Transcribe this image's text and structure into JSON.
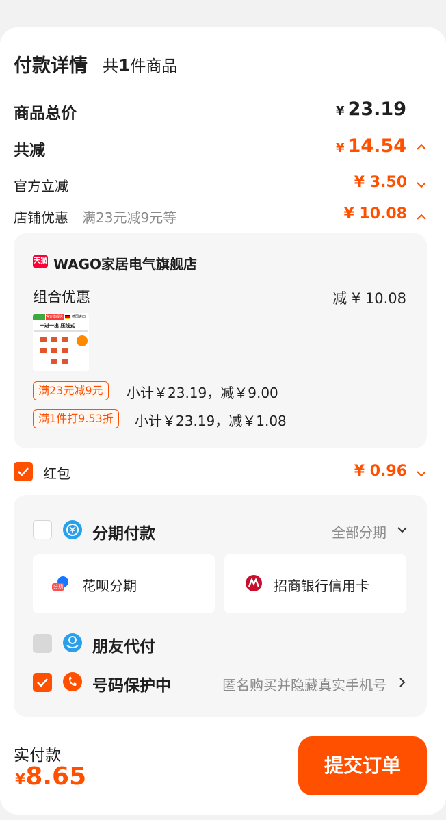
{
  "header": {
    "title": "付款详情",
    "count_text_prefix": "共",
    "count": "1",
    "count_text_suffix": "件商品"
  },
  "summary": {
    "total_label": "商品总价",
    "total_currency": "¥",
    "total_value": "23.19",
    "discount_label": "共减",
    "discount_currency": "¥",
    "discount_value": "14.54",
    "official_label": "官方立减",
    "official_value": "¥ 3.50",
    "shop_label": "店铺优惠",
    "shop_note": "满23元减9元等",
    "shop_value": "¥ 10.08"
  },
  "store": {
    "logo_text": "天猫",
    "name": "WAGO家居电气旗舰店",
    "combo_label": "组合优惠",
    "combo_prefix": "减",
    "combo_value": "¥ 10.08",
    "thumb": {
      "top_left": "官方旗舰店",
      "top_right": "德国进口",
      "headline": "一进一出 压线式"
    },
    "promos": [
      {
        "tag": "满23元减9元",
        "text": "小计￥23.19，减￥9.00"
      },
      {
        "tag": "满1件打9.53折",
        "text": "小计￥23.19，减￥1.08"
      }
    ]
  },
  "red_packet": {
    "label": "红包",
    "value": "¥ 0.96",
    "checked": true
  },
  "payment": {
    "installment_label": "分期付款",
    "installment_option": "全部分期",
    "cards": [
      {
        "label": "花呗分期",
        "icon": "huabei-icon",
        "badge": "分期"
      },
      {
        "label": "招商银行信用卡",
        "icon": "cmb-bank-icon"
      }
    ],
    "friend_pay_label": "朋友代付",
    "privacy_label": "号码保护中",
    "privacy_note": "匿名购买并隐藏真实手机号"
  },
  "footer": {
    "actual_label": "实付款",
    "currency": "¥",
    "amount": "8.65",
    "submit_label": "提交订单"
  },
  "colors": {
    "accent": "#ff5000",
    "info_blue": "#2aa0ea"
  }
}
